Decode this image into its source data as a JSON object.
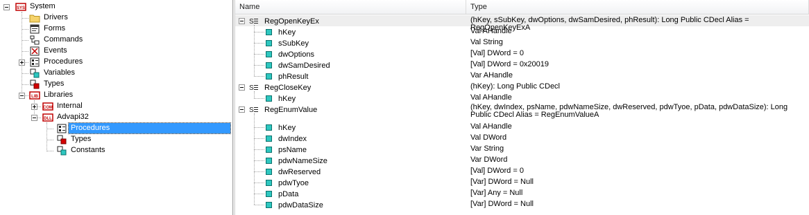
{
  "tree": {
    "items": [
      {
        "label": "System",
        "icon": "sys-module-icon",
        "name": "tree-item-system"
      },
      {
        "label": "Drivers",
        "icon": "folder-icon",
        "name": "tree-item-drivers"
      },
      {
        "label": "Forms",
        "icon": "form-icon",
        "name": "tree-item-forms"
      },
      {
        "label": "Commands",
        "icon": "commands-icon",
        "name": "tree-item-commands"
      },
      {
        "label": "Events",
        "icon": "events-icon",
        "name": "tree-item-events"
      },
      {
        "label": "Procedures",
        "icon": "procedures-icon",
        "name": "tree-item-procedures"
      },
      {
        "label": "Variables",
        "icon": "variables-icon",
        "name": "tree-item-variables"
      },
      {
        "label": "Types",
        "icon": "types-icon",
        "name": "tree-item-types"
      },
      {
        "label": "Libraries",
        "icon": "libraries-icon",
        "name": "tree-item-libraries"
      },
      {
        "label": "Internal",
        "icon": "com-library-icon",
        "name": "tree-item-internal"
      },
      {
        "label": "Advapi32",
        "icon": "dll-library-icon",
        "name": "tree-item-advapi32"
      },
      {
        "label": "Procedures",
        "icon": "procedures-icon",
        "name": "tree-item-advapi32-procedures"
      },
      {
        "label": "Types",
        "icon": "types-icon",
        "name": "tree-item-advapi32-types"
      },
      {
        "label": "Constants",
        "icon": "constants-icon",
        "name": "tree-item-advapi32-constants"
      }
    ]
  },
  "grid": {
    "columns": {
      "name": "Name",
      "type": "Type"
    },
    "rows": [
      {
        "name": "RegOpenKeyEx",
        "type": "(hKey, sSubKey, dwOptions, dwSamDesired, phResult): Long Public CDecl Alias = RegOpenKeyExA",
        "kind": "function"
      },
      {
        "name": "hKey",
        "type": "Val AHandle",
        "kind": "param"
      },
      {
        "name": "sSubKey",
        "type": "Val String",
        "kind": "param"
      },
      {
        "name": "dwOptions",
        "type": "[Val] DWord = 0",
        "kind": "param"
      },
      {
        "name": "dwSamDesired",
        "type": "[Val] DWord = 0x20019",
        "kind": "param"
      },
      {
        "name": "phResult",
        "type": "Var AHandle",
        "kind": "param"
      },
      {
        "name": "RegCloseKey",
        "type": "(hKey): Long Public CDecl",
        "kind": "function"
      },
      {
        "name": "hKey",
        "type": "Val AHandle",
        "kind": "param"
      },
      {
        "name": "RegEnumValue",
        "type": "(hKey, dwIndex, psName, pdwNameSize, dwReserved, pdwTyoe, pData, pdwDataSize): Long Public CDecl Alias = RegEnumValueA",
        "kind": "function"
      },
      {
        "name": "hKey",
        "type": "Val AHandle",
        "kind": "param"
      },
      {
        "name": "dwIndex",
        "type": "Val DWord",
        "kind": "param"
      },
      {
        "name": "psName",
        "type": "Var String",
        "kind": "param"
      },
      {
        "name": "pdwNameSize",
        "type": "Var DWord",
        "kind": "param"
      },
      {
        "name": "dwReserved",
        "type": "[Val] DWord = 0",
        "kind": "param"
      },
      {
        "name": "pdwTyoe",
        "type": "[Var] DWord = Null",
        "kind": "param"
      },
      {
        "name": "pData",
        "type": "[Var] Any = Null",
        "kind": "param"
      },
      {
        "name": "pdwDataSize",
        "type": "[Var] DWord = Null",
        "kind": "param"
      }
    ]
  }
}
